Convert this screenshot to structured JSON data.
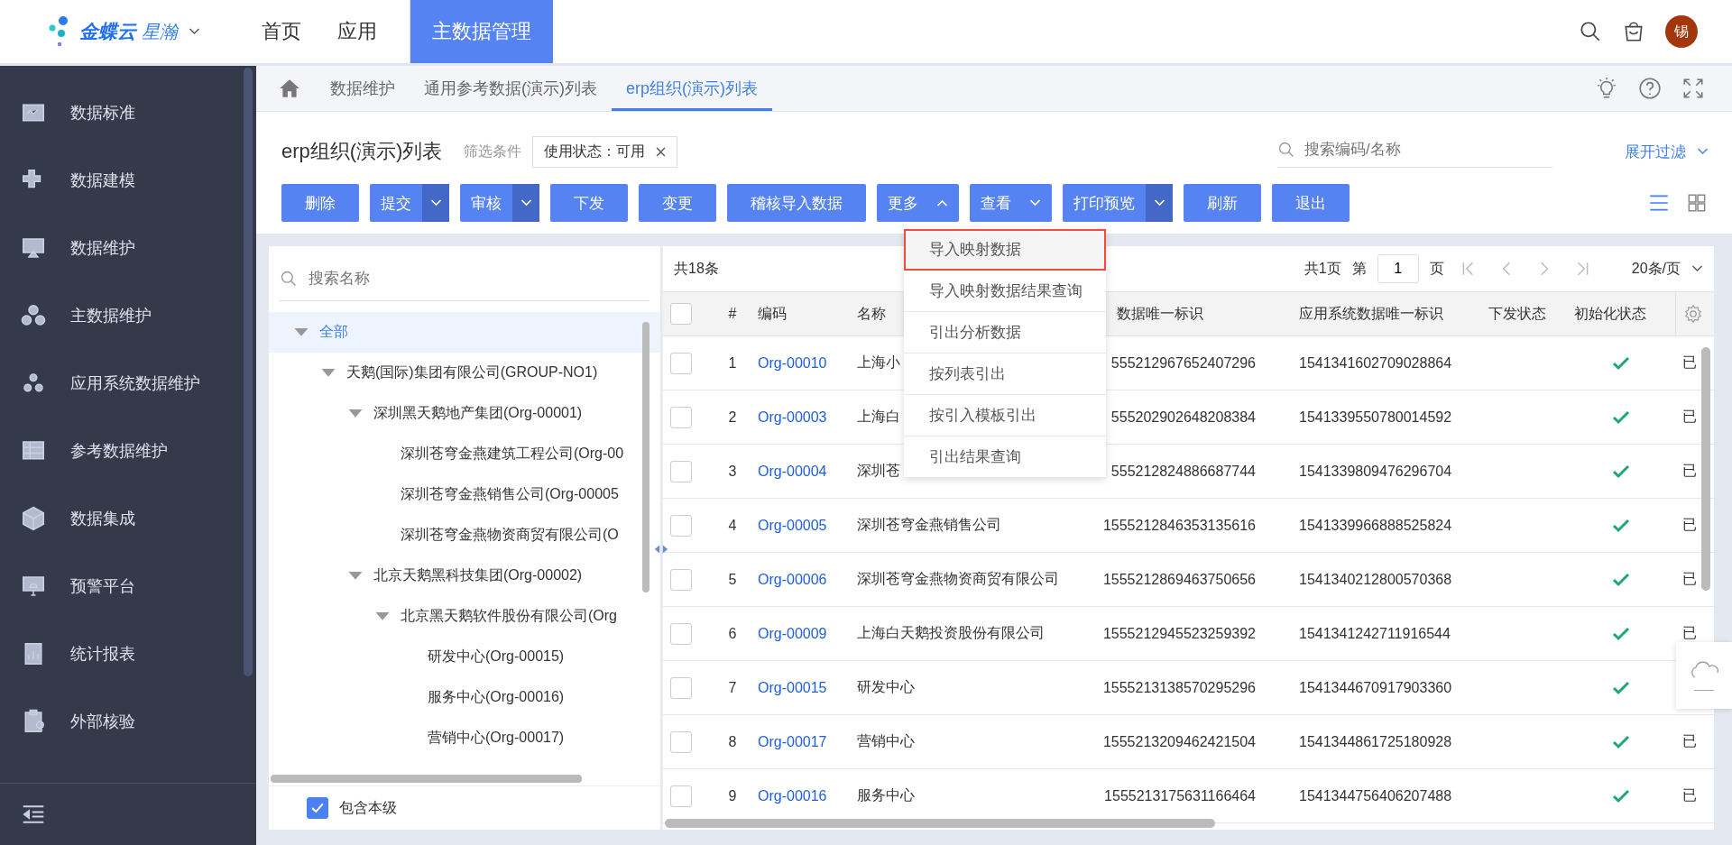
{
  "header": {
    "brand": "金蝶云",
    "brand_sub": "星瀚",
    "nav": [
      {
        "label": "首页",
        "selected": false
      },
      {
        "label": "应用",
        "selected": false
      },
      {
        "label": "主数据管理",
        "selected": true
      }
    ],
    "avatar": "锡"
  },
  "sidebar": {
    "items": [
      {
        "label": "数据标准"
      },
      {
        "label": "数据建模"
      },
      {
        "label": "数据维护"
      },
      {
        "label": "主数据维护"
      },
      {
        "label": "应用系统数据维护"
      },
      {
        "label": "参考数据维护"
      },
      {
        "label": "数据集成"
      },
      {
        "label": "预警平台"
      },
      {
        "label": "统计报表"
      },
      {
        "label": "外部核验"
      }
    ]
  },
  "breadcrumb": [
    {
      "label": "数据维护",
      "selected": false
    },
    {
      "label": "通用参考数据(演示)列表",
      "selected": false
    },
    {
      "label": "erp组织(演示)列表",
      "selected": true
    }
  ],
  "page": {
    "title": "erp组织(演示)列表",
    "filter_label": "筛选条件",
    "filter_tag": "使用状态：可用",
    "search_placeholder": "搜索编码/名称",
    "expand_filter": "展开过滤"
  },
  "buttons": [
    {
      "label": "删除",
      "kind": "plain"
    },
    {
      "label": "提交",
      "kind": "split"
    },
    {
      "label": "审核",
      "kind": "split"
    },
    {
      "label": "下发",
      "kind": "plain"
    },
    {
      "label": "变更",
      "kind": "plain"
    },
    {
      "label": "稽核导入数据",
      "kind": "plain"
    },
    {
      "label": "更多",
      "kind": "dropdown",
      "expanded": true
    },
    {
      "label": "查看",
      "kind": "dropdown",
      "expanded": false
    },
    {
      "label": "打印预览",
      "kind": "split"
    },
    {
      "label": "刷新",
      "kind": "plain"
    },
    {
      "label": "退出",
      "kind": "plain"
    }
  ],
  "more_menu": [
    {
      "label": "导入映射数据",
      "selected": true
    },
    {
      "label": "导入映射数据结果查询",
      "selected": false
    },
    {
      "label": "引出分析数据",
      "selected": false
    },
    {
      "label": "按列表引出",
      "selected": false
    },
    {
      "label": "按引入模板引出",
      "selected": false
    },
    {
      "label": "引出结果查询",
      "selected": false
    }
  ],
  "tree": {
    "search_placeholder": "搜索名称",
    "include_self": {
      "label": "包含本级",
      "checked": true
    },
    "nodes": [
      {
        "label": "全部",
        "selected": true,
        "expanded": true,
        "children": [
          {
            "label": "天鹅(国际)集团有限公司(GROUP-NO1)",
            "selected": false,
            "expanded": true,
            "children": [
              {
                "label": "深圳黑天鹅地产集团(Org-00001)",
                "selected": false,
                "expanded": true,
                "children": [
                  {
                    "label": "深圳苍穹金燕建筑工程公司(Org-00",
                    "selected": false
                  },
                  {
                    "label": "深圳苍穹金燕销售公司(Org-00005",
                    "selected": false
                  },
                  {
                    "label": "深圳苍穹金燕物资商贸有限公司(O",
                    "selected": false
                  }
                ]
              },
              {
                "label": "北京天鹅黑科技集团(Org-00002)",
                "selected": false,
                "expanded": true,
                "children": [
                  {
                    "label": "北京黑天鹅软件股份有限公司(Org",
                    "selected": false,
                    "expanded": true,
                    "children": [
                      {
                        "label": "研发中心(Org-00015)",
                        "selected": false
                      },
                      {
                        "label": "服务中心(Org-00016)",
                        "selected": false
                      },
                      {
                        "label": "营销中心(Org-00017)",
                        "selected": false
                      }
                    ]
                  }
                ]
              }
            ]
          }
        ]
      }
    ]
  },
  "table": {
    "total": "共18条",
    "pages": "共1页",
    "page_prefix": "第",
    "page_value": "1",
    "page_suffix": "页",
    "page_size": "20条/页",
    "select_all_checked": false,
    "columns": [
      "#",
      "编码",
      "名称",
      "数据唯一标识",
      "应用系统数据唯一标识",
      "下发状态",
      "初始化状态"
    ],
    "rows": [
      {
        "checked": false,
        "num": "1",
        "code": "Org-00010",
        "name": "上海小",
        "id1": "555212967652407296",
        "id2": "1541341602709028864",
        "initialized": true,
        "status": "已"
      },
      {
        "checked": false,
        "num": "2",
        "code": "Org-00003",
        "name": "上海白",
        "id1": "555202902648208384",
        "id2": "1541339550780014592",
        "initialized": true,
        "status": "已"
      },
      {
        "checked": false,
        "num": "3",
        "code": "Org-00004",
        "name": "深圳苍",
        "id1": "555212824886687744",
        "id2": "1541339809476296704",
        "initialized": true,
        "status": "已"
      },
      {
        "checked": false,
        "num": "4",
        "code": "Org-00005",
        "name": "深圳苍穹金燕销售公司",
        "id1": "1555212846353135616",
        "id2": "1541339966888525824",
        "initialized": true,
        "status": "已"
      },
      {
        "checked": false,
        "num": "5",
        "code": "Org-00006",
        "name": "深圳苍穹金燕物资商贸有限公司",
        "id1": "1555212869463750656",
        "id2": "1541340212800570368",
        "initialized": true,
        "status": "已"
      },
      {
        "checked": false,
        "num": "6",
        "code": "Org-00009",
        "name": "上海白天鹅投资股份有限公司",
        "id1": "1555212945523259392",
        "id2": "1541341242711916544",
        "initialized": true,
        "status": "已"
      },
      {
        "checked": false,
        "num": "7",
        "code": "Org-00015",
        "name": "研发中心",
        "id1": "1555213138570295296",
        "id2": "1541344670917903360",
        "initialized": true
      },
      {
        "checked": false,
        "num": "8",
        "code": "Org-00017",
        "name": "营销中心",
        "id1": "1555213209462421504",
        "id2": "1541344861725180928",
        "initialized": true,
        "status": "已"
      },
      {
        "checked": false,
        "num": "9",
        "code": "Org-00016",
        "name": "服务中心",
        "id1": "1555213175631166464",
        "id2": "1541344756406207488",
        "initialized": true,
        "status": "已"
      }
    ]
  }
}
